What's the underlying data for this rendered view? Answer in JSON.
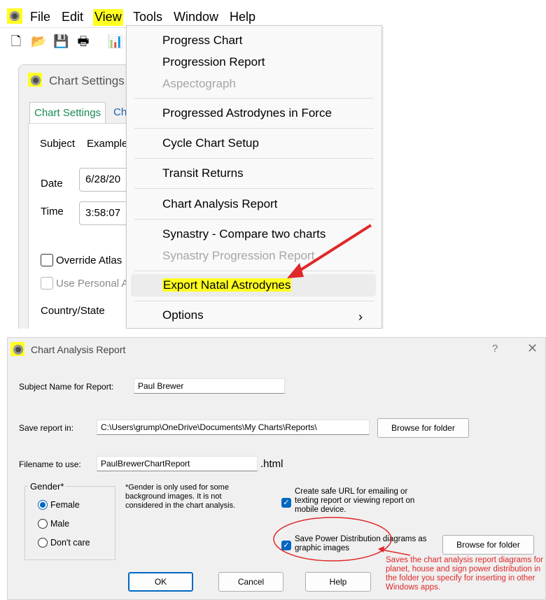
{
  "menubar": {
    "items": [
      "File",
      "Edit",
      "View",
      "Tools",
      "Window",
      "Help"
    ]
  },
  "background_window": {
    "title": "Chart Settings",
    "tabs": [
      "Chart Settings",
      "Ch"
    ],
    "subject_label": "Subject",
    "subject_value": "Example",
    "date_label": "Date",
    "date_value": "6/28/20",
    "time_label": "Time",
    "time_value": "3:58:07",
    "override_atlas_label": "Override Atlas",
    "use_personal_label": "Use Personal A",
    "country_state_label": "Country/State"
  },
  "tools_menu": {
    "items": [
      {
        "label": "Progress Chart",
        "disabled": false
      },
      {
        "label": "Progression Report",
        "disabled": false
      },
      {
        "label": "Aspectograph",
        "disabled": true
      },
      {
        "label": "Progressed Astrodynes in Force",
        "disabled": false
      },
      {
        "label": "Cycle Chart Setup",
        "disabled": false
      },
      {
        "label": "Transit Returns",
        "disabled": false
      },
      {
        "label": "Chart Analysis Report",
        "disabled": false
      },
      {
        "label": "Synastry - Compare two charts",
        "disabled": false
      },
      {
        "label": "Synastry Progression Report",
        "disabled": true
      },
      {
        "label": "Export Natal Astrodynes",
        "disabled": false
      },
      {
        "label": "Options",
        "disabled": false
      }
    ]
  },
  "dialog": {
    "title": "Chart Analysis Report",
    "help_glyph": "?",
    "close_glyph": "✕",
    "subject_label": "Subject Name for Report:",
    "subject_value": "Paul Brewer",
    "save_label": "Save report in:",
    "save_value": "C:\\Users\\grump\\OneDrive\\Documents\\My Charts\\Reports\\",
    "browse_label": "Browse for folder",
    "filename_label": "Filename to use:",
    "filename_value": "PaulBrewerChartReport",
    "extension": ".html",
    "gender": {
      "title": "Gender*",
      "options": [
        "Female",
        "Male",
        "Don't care"
      ],
      "selected": "Female"
    },
    "gender_note": "*Gender is only used for some background images. It is not considered in the chart analysis.",
    "safe_url_label": "Create safe URL for emailing or texting report or viewing report on mobile device.",
    "save_power_label": "Save Power Distribution diagrams as graphic images",
    "browse2_label": "Browse for folder",
    "ok_label": "OK",
    "cancel_label": "Cancel",
    "help_label": "Help",
    "annotation": "Saves the chart analysis report diagrams for planet, house and sign power distribution in the folder you specify for inserting in other Windows apps."
  },
  "colors": {
    "highlight": "#ffff20",
    "annotation_red": "#e0282a",
    "accent_blue": "#0067c0"
  }
}
